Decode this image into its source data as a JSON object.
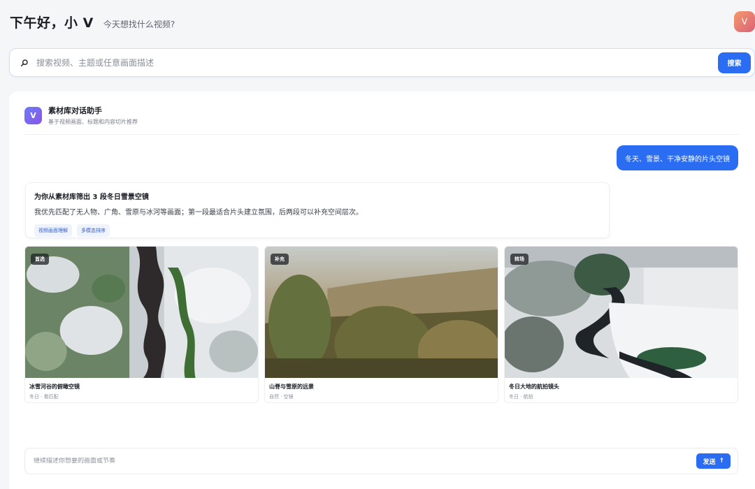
{
  "header": {
    "greeting": "下午好，小 V",
    "subtitle": "今天想找什么视频?",
    "avatar_letter": "V"
  },
  "search": {
    "icon": "search-icon",
    "placeholder": "搜索视频、主题或任意画面描述",
    "button_label": "搜索"
  },
  "assistant": {
    "logo_letter": "V",
    "title": "素材库对话助手",
    "subtitle": "基于视频画面、标题和内容切片推荐"
  },
  "conversation": {
    "user_message": "冬天、雪景、干净安静的片头空镜",
    "reply_title": "为你从素材库筛出 3 段冬日雪景空镜",
    "reply_body": "我优先匹配了无人物、广角、雪原与冰河等画面；第一段最适合片头建立氛围，后两段可以补充空间层次。",
    "tags": [
      "视频画面理解",
      "多模态排序"
    ]
  },
  "videos": [
    {
      "badge": "首选",
      "title": "冰雪河谷的俯瞰空镜",
      "meta": "冬日 · 看匹配"
    },
    {
      "badge": "补充",
      "title": "山脊与雪原的远景",
      "meta": "自然 · 空镜"
    },
    {
      "badge": "转场",
      "title": "冬日大地的航拍镜头",
      "meta": "冬日 · 航拍"
    }
  ],
  "composer": {
    "placeholder": "继续描述你想要的画面或节奏",
    "send_label": "发送",
    "send_icon": "↑"
  },
  "colors": {
    "accent": "#2a6df2",
    "background": "#f5f6f8",
    "avatar_gradient": [
      "#f59a6b",
      "#d9627a"
    ],
    "logo_gradient": [
      "#6a7cf5",
      "#8a55e8"
    ]
  }
}
